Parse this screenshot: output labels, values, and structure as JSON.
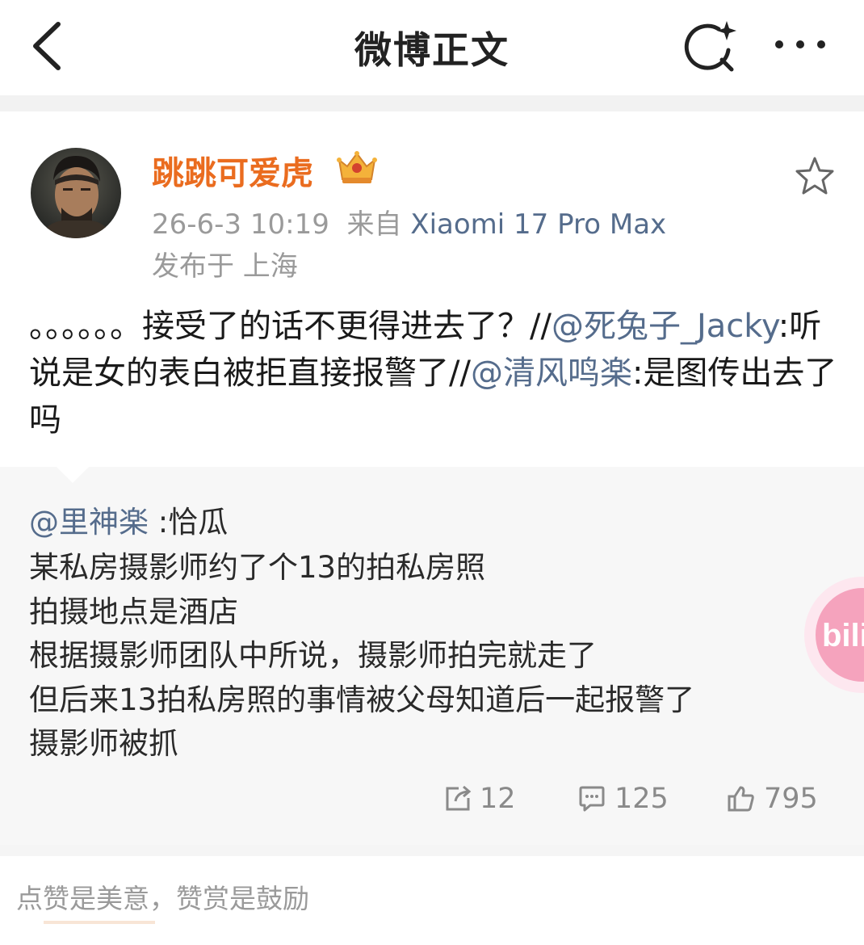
{
  "nav": {
    "title": "微博正文",
    "back_icon": "chevron-left-icon",
    "search_icon": "search-sparkle-icon",
    "more_icon": "more-dots-icon"
  },
  "post": {
    "author": "跳跳可爱虎",
    "badge_icon": "crown-badge-icon",
    "time": "26-6-3 10:19",
    "source_prefix": "来自",
    "device": "Xiaomi 17 Pro Max",
    "location": "发布于 上海",
    "text_part1": "。。。。。。接受了的话不更得进去了？//",
    "mention1": "@死兔子_Jacky",
    "text_part2": ":听说是女的表白被拒直接报警了//",
    "mention2": "@清风鸣楽",
    "text_part3": ":是图传出去了吗"
  },
  "retweet": {
    "mention": "@里神楽",
    "mention_suffix": " :恰瓜",
    "lines": [
      "某私房摄影师约了个13的拍私房照",
      "拍摄地点是酒店",
      "根据摄影师团队中所说，摄影师拍完就走了",
      "但后来13拍私房照的事情被父母知道后一起报警了",
      "摄影师被抓"
    ],
    "stats": {
      "reposts": "12",
      "comments": "125",
      "likes": "795"
    }
  },
  "overlay": {
    "bili_text": "bili"
  },
  "footer": {
    "reward_text": "点赞是美意，赞赏是鼓励"
  },
  "colors": {
    "username": "#ea6c1f",
    "link": "#556c8c",
    "muted": "#9a9a9a"
  }
}
